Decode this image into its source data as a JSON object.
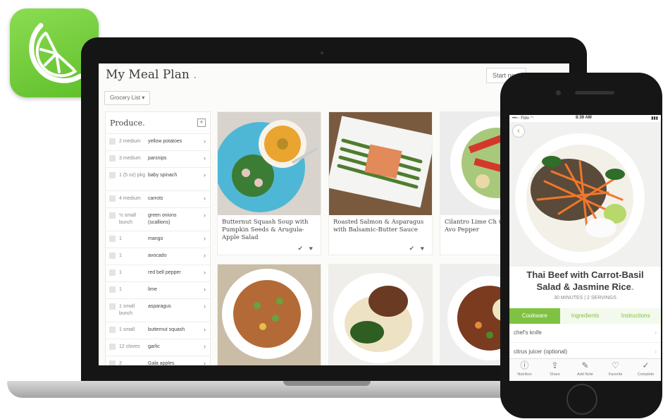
{
  "colors": {
    "brand_green": "#7fc241",
    "text_dark": "#3d3d3d"
  },
  "laptop": {
    "page_title": "My Meal Plan",
    "title_dot": ".",
    "start_button": "Start next",
    "grocery_button": "Grocery List ▾",
    "sidebar": {
      "title": "Produce.",
      "add_icon": "plus-square-icon",
      "items": [
        {
          "qty": "2 medium",
          "name": "yellow potatoes"
        },
        {
          "qty": "3 medium",
          "name": "parsnips"
        },
        {
          "qty": "1 (5 oz) pkg",
          "name": "baby spinach"
        },
        {
          "qty": "4 medium",
          "name": "carrots"
        },
        {
          "qty": "½ small bunch",
          "name": "green onions (scallions)"
        },
        {
          "qty": "1",
          "name": "mango"
        },
        {
          "qty": "1",
          "name": "avocado"
        },
        {
          "qty": "1",
          "name": "red bell pepper"
        },
        {
          "qty": "1",
          "name": "lime"
        },
        {
          "qty": "1 small bunch",
          "name": "asparagus"
        },
        {
          "qty": "1 small",
          "name": "butternut squash"
        },
        {
          "qty": "12 cloves",
          "name": "garlic"
        },
        {
          "qty": "2",
          "name": "Gala apples"
        }
      ]
    },
    "cards": [
      {
        "title": "Butternut Squash Soup with Pumpkin Seeds & Arugula-Apple Salad",
        "actions": "✔ ♥"
      },
      {
        "title": "Roasted Salmon & Asparagus with Balsamic-Butter Sauce",
        "actions": "✔ ♥"
      },
      {
        "title": "Cilantro Lime Ch with Mango, Avo Pepper",
        "actions": ""
      }
    ]
  },
  "phone": {
    "status": {
      "carrier": "•••◦◦ Fido ◠",
      "time": "8:39 AM",
      "battery": "▮▮▮"
    },
    "back_icon": "chevron-left-icon",
    "title": "Thai Beef with Carrot-Basil Salad & Jasmine Rice",
    "title_dot": ".",
    "meta": "30 MINUTES  |  2 SERVINGS",
    "tabs": [
      "Cookware",
      "Ingredients",
      "Instructions"
    ],
    "items": [
      "chef's knife",
      "citrus juicer (optional)"
    ],
    "toolbar": [
      {
        "icon": "info-icon",
        "label": "Nutrition"
      },
      {
        "icon": "share-icon",
        "label": "Share"
      },
      {
        "icon": "note-icon",
        "label": "Add Note"
      },
      {
        "icon": "heart-icon",
        "label": "Favorite"
      },
      {
        "icon": "check-circle-icon",
        "label": "Complete"
      }
    ]
  }
}
